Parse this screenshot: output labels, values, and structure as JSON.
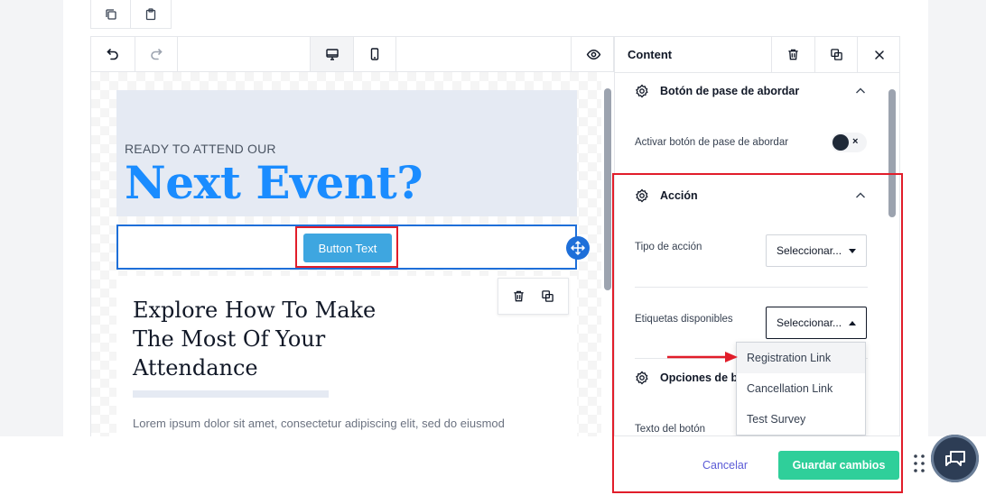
{
  "canvas": {
    "hero_subtitle": "READY TO ATTEND OUR",
    "hero_title": "Next Event?",
    "button_sample_label": "Button Text",
    "explore_title": "Explore How To Make The Most Of Your Attendance",
    "lorem_text": "Lorem ipsum dolor sit amet, consectetur adipiscing elit, sed do eiusmod"
  },
  "panel": {
    "title": "Content",
    "sections": {
      "boarding_pass": {
        "title": "Botón de pase de abordar",
        "toggle_label": "Activar botón de pase de abordar",
        "toggle_on": false,
        "toggle_off_glyph": "×"
      },
      "action": {
        "title": "Acción",
        "action_type_label": "Tipo de acción",
        "action_type_value": "Seleccionar...",
        "tags_label": "Etiquetas disponibles",
        "tags_value": "Seleccionar..."
      },
      "button_options": {
        "title": "Opciones de bo",
        "button_text_label": "Texto del botón"
      }
    },
    "dropdown_options": [
      "Registration Link",
      "Cancellation Link",
      "Test Survey"
    ]
  },
  "footer": {
    "cancel_label": "Cancelar",
    "save_label": "Guardar cambios"
  },
  "colors": {
    "accent_blue": "#1a8cff",
    "selection_blue": "#1e6fd9",
    "button_sample": "#3ea6e0",
    "save_green": "#2fcf9a",
    "cancel_purple": "#5b5bd6",
    "annotation_red": "#e11d2a",
    "chat_fab": "#2d3d55"
  },
  "icons": {
    "mini_toolbar": [
      "copy-icon",
      "clipboard-icon"
    ],
    "editor_toolbar": [
      "undo-icon",
      "redo-icon",
      "desktop-icon",
      "mobile-icon",
      "eye-icon"
    ],
    "panel_header": [
      "trash-icon",
      "duplicate-icon",
      "close-icon"
    ],
    "section": "gear-icon",
    "fab": "chat-icon"
  }
}
